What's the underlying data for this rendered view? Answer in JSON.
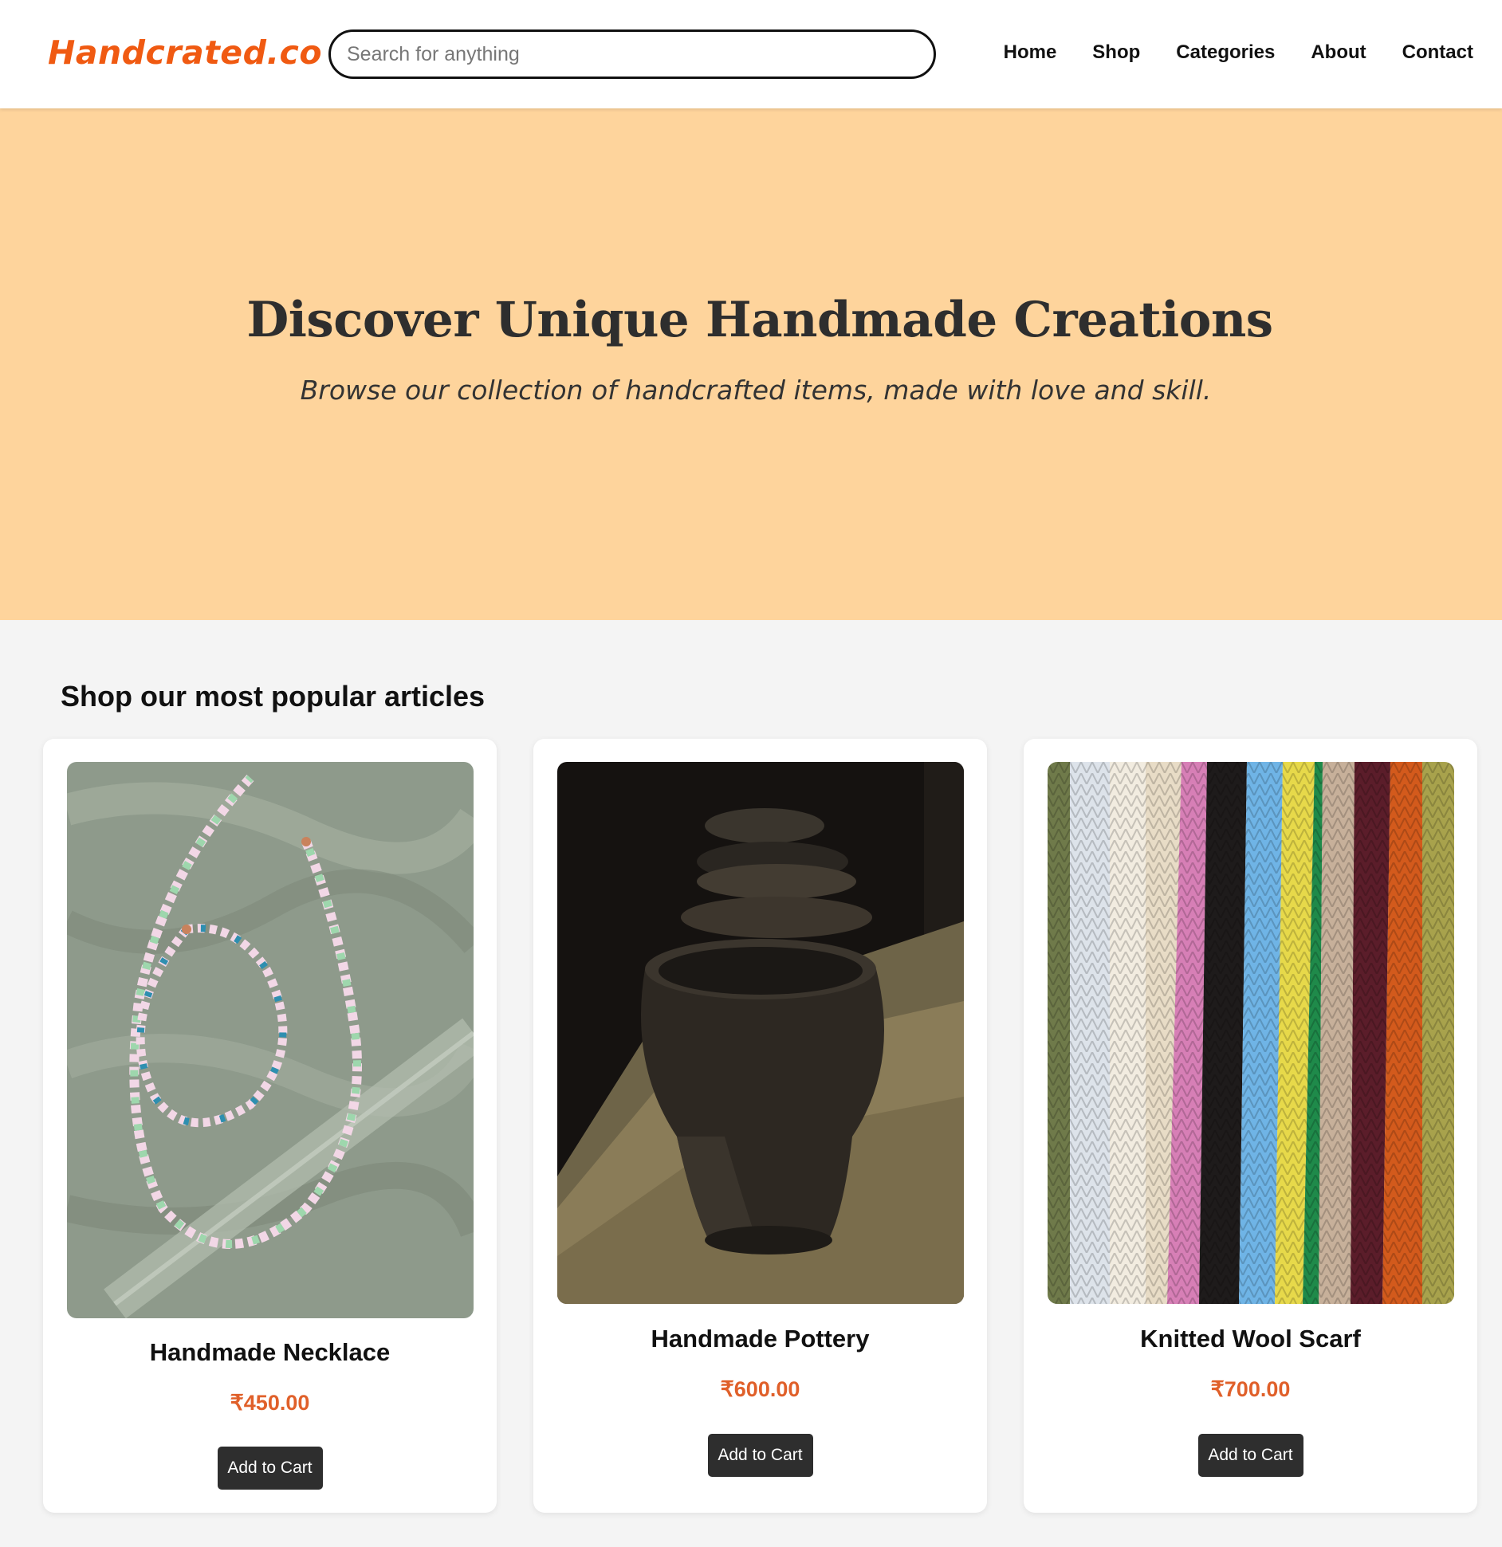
{
  "header": {
    "logo": "Handcrated.co",
    "search_placeholder": "Search for anything",
    "nav": [
      "Home",
      "Shop",
      "Categories",
      "About",
      "Contact"
    ]
  },
  "hero": {
    "title": "Discover Unique Handmade Creations",
    "subtitle": "Browse our collection of handcrafted items, made with love and skill."
  },
  "products_section": {
    "title": "Shop our most popular articles",
    "products": [
      {
        "name": "Handmade Necklace",
        "price": "₹450.00",
        "button": "Add to Cart",
        "image": "beaded-necklace-photo"
      },
      {
        "name": "Handmade Pottery",
        "price": "₹600.00",
        "button": "Add to Cart",
        "image": "clay-pot-photo"
      },
      {
        "name": "Knitted Wool Scarf",
        "price": "₹700.00",
        "button": "Add to Cart",
        "image": "knitted-scarf-photo"
      }
    ]
  },
  "colors": {
    "brand": "#f05a12",
    "hero_bg": "#fed49c",
    "price": "#e0602a",
    "button_bg": "#2e2e2e",
    "page_bg": "#f4f4f4"
  }
}
